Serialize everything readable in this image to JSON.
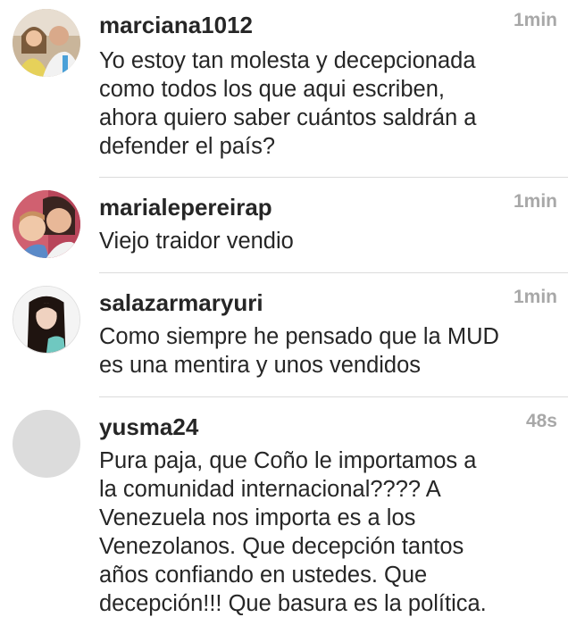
{
  "comments": [
    {
      "username": "marciana1012",
      "time": "1min",
      "text_lines": [
        "Yo estoy tan molesta y decepcionada",
        "como todos los que aqui escriben,",
        "ahora quiero saber cuántos saldrán a",
        "defender el país?"
      ]
    },
    {
      "username": "marialepereirap",
      "time": "1min",
      "text_lines": [
        "Viejo traidor vendio"
      ]
    },
    {
      "username": "salazarmaryuri",
      "time": "1min",
      "text_lines": [
        "Como siempre he pensado que la MUD",
        "es una mentira y unos vendidos"
      ]
    },
    {
      "username": "yusma24",
      "time": "48s",
      "text_lines": [
        "Pura paja,  que Coño  le importamos a",
        "la comunidad internacional???? A",
        "Venezuela nos importa es a los",
        "Venezolanos.  Que decepción tantos",
        "años confiando en ustedes.  Que",
        "decepción!!! Que basura es la política."
      ]
    }
  ],
  "colors": {
    "text": "#262626",
    "timestamp": "#a8a8a8",
    "divider": "#dbdbdb",
    "placeholder_avatar": "#dcdcdc"
  }
}
